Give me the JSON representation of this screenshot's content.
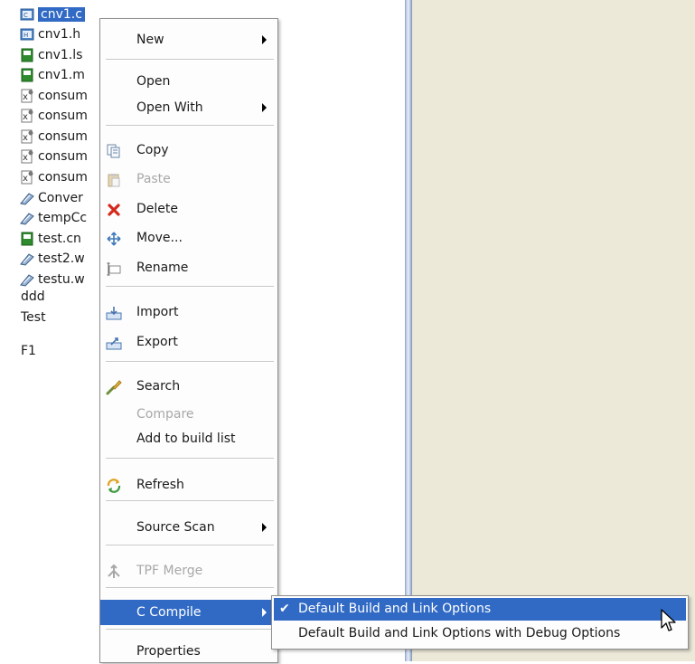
{
  "tree": {
    "files": [
      {
        "label": "cnv1.c",
        "icon": "c-source-file-icon",
        "selected": true
      },
      {
        "label": "cnv1.h",
        "icon": "c-header-file-icon"
      },
      {
        "label": "cnv1.ls",
        "icon": "listing-file-icon"
      },
      {
        "label": "cnv1.m",
        "icon": "listing-file-icon"
      },
      {
        "label": "consum",
        "icon": "script-file-icon"
      },
      {
        "label": "consum",
        "icon": "script-file-icon"
      },
      {
        "label": "consum",
        "icon": "script-file-icon"
      },
      {
        "label": "consum",
        "icon": "script-file-icon"
      },
      {
        "label": "consum",
        "icon": "script-file-icon"
      },
      {
        "label": "Conver",
        "icon": "wizard-file-icon"
      },
      {
        "label": "tempCc",
        "icon": "wizard-file-icon"
      },
      {
        "label": "test.cn",
        "icon": "listing-file-icon"
      },
      {
        "label": "test2.w",
        "icon": "wizard-file-icon"
      },
      {
        "label": "testu.w",
        "icon": "wizard-file-icon"
      }
    ],
    "plain_items": [
      "ddd",
      "Test",
      "F1"
    ]
  },
  "context_menu": {
    "items": [
      {
        "label": "New",
        "submenu": true
      },
      {
        "separator": true
      },
      {
        "label": "Open"
      },
      {
        "label": "Open With",
        "submenu": true
      },
      {
        "separator": true
      },
      {
        "label": "Copy",
        "icon": "copy-icon"
      },
      {
        "label": "Paste",
        "icon": "paste-icon",
        "disabled": true
      },
      {
        "label": "Delete",
        "icon": "delete-icon"
      },
      {
        "label": "Move...",
        "icon": "move-icon"
      },
      {
        "label": "Rename",
        "icon": "rename-icon"
      },
      {
        "separator": true
      },
      {
        "label": "Import",
        "icon": "import-icon"
      },
      {
        "label": "Export",
        "icon": "export-icon"
      },
      {
        "separator": true
      },
      {
        "label": "Search",
        "icon": "search-icon"
      },
      {
        "label": "Compare",
        "disabled": true
      },
      {
        "label": "Add to build list"
      },
      {
        "separator": true
      },
      {
        "label": "Refresh",
        "icon": "refresh-icon"
      },
      {
        "separator": true
      },
      {
        "label": "Source Scan",
        "submenu": true
      },
      {
        "separator": true
      },
      {
        "label": "TPF Merge",
        "icon": "merge-icon",
        "disabled": true
      },
      {
        "separator": true
      },
      {
        "label": "C Compile",
        "submenu": true,
        "highlighted": true
      },
      {
        "separator": true
      },
      {
        "label": "Properties"
      }
    ]
  },
  "submenu": {
    "items": [
      {
        "label": "Default Build and Link Options",
        "checked": true,
        "highlighted": true
      },
      {
        "label": "Default Build and Link Options with Debug Options"
      }
    ]
  },
  "colors": {
    "selection": "#316ac5",
    "right_panel": "#ece9d8",
    "menu_background": "#fdfdfd",
    "disabled_text": "#a8a8a8"
  }
}
